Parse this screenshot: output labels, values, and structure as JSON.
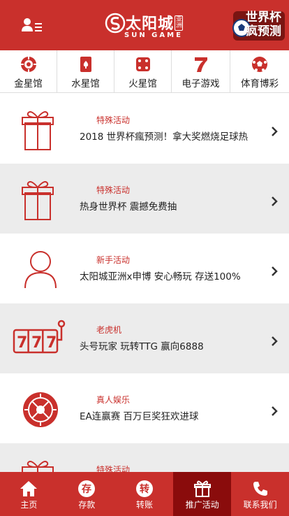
{
  "header": {
    "user_icon": "user-menu-icon",
    "logo": {
      "cn": "太阳城",
      "tag": "亚洲",
      "en": "SUN GAME"
    },
    "promo": {
      "line1": "世界杯",
      "line2": "疯预测",
      "icon": "soccer-ball-icon"
    }
  },
  "categories": [
    {
      "label": "金星馆",
      "icon": "roulette-chip-icon"
    },
    {
      "label": "水星馆",
      "icon": "playing-card-icon"
    },
    {
      "label": "火星馆",
      "icon": "dice-icon"
    },
    {
      "label": "电子游戏",
      "icon": "slot-seven-icon"
    },
    {
      "label": "体育博彩",
      "icon": "soccer-ball-icon"
    }
  ],
  "promotions": [
    {
      "tag": "特殊活动",
      "title": "2018 世界杯瘋预测！拿大奖燃烧足球热",
      "icon": "gift-icon"
    },
    {
      "tag": "特殊活动",
      "title": "热身世界杯 震撼免费抽",
      "icon": "gift-icon"
    },
    {
      "tag": "新手活动",
      "title": "太阳城亚洲x申博 安心畅玩 存送100%",
      "icon": "user-icon"
    },
    {
      "tag": "老虎机",
      "title": "头号玩家 玩转TTG 赢向6888",
      "icon": "slot-machine-icon"
    },
    {
      "tag": "真人娱乐",
      "title": "EA连赢赛 百万巨奖狂欢进球",
      "icon": "roulette-icon"
    },
    {
      "tag": "特殊活动",
      "title": "",
      "icon": "gift-icon"
    }
  ],
  "tabbar": [
    {
      "label": "主页",
      "icon": "home-icon",
      "active": false
    },
    {
      "label": "存款",
      "icon": "deposit-icon",
      "glyph": "存",
      "active": false
    },
    {
      "label": "转账",
      "icon": "transfer-icon",
      "glyph": "转",
      "active": false
    },
    {
      "label": "推广活动",
      "icon": "gift-icon",
      "active": true
    },
    {
      "label": "联系我们",
      "icon": "phone-icon",
      "active": false
    }
  ],
  "colors": {
    "brand_red": "#c9302c",
    "active_tab": "#8a0c0c",
    "alt_row": "#ececec"
  }
}
